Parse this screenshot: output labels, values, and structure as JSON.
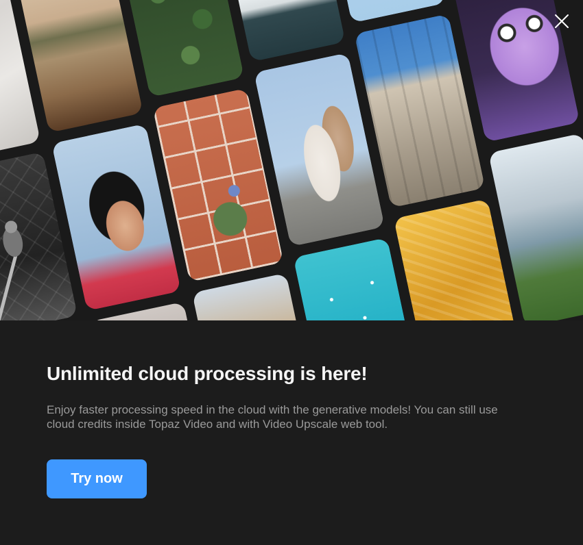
{
  "modal": {
    "close_icon": "close-icon",
    "title": "Unlimited cloud processing is here!",
    "description": "Enjoy faster processing speed in the cloud with the generative models! You can still use cloud credits inside Topaz Video and with Video Upscale web tool.",
    "cta_label": "Try now"
  },
  "colors": {
    "background": "#1c1c1c",
    "title": "#f5f5f5",
    "description": "#9a9a9a",
    "accent": "#3f98ff"
  },
  "hero": {
    "tiles": [
      "photo-sand-dunes",
      "photo-bird-on-fence",
      "photo-beach-cliffs",
      "photo-woman-portrait",
      "photo-three-men",
      "photo-palm-forest",
      "photo-flowers-on-tiles",
      "photo-church-dome",
      "photo-boat-on-water",
      "photo-fashion-models",
      "photo-surfers-ocean",
      "photo-ferris-wheel",
      "photo-louvre-building",
      "photo-golden-texture",
      "photo-picnic-table",
      "photo-fluffy-monster",
      "photo-mountain-valley"
    ]
  }
}
